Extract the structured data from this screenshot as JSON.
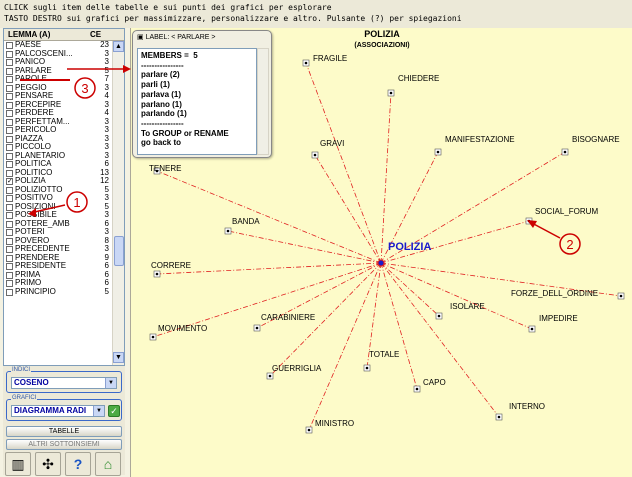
{
  "hint": {
    "line1": "CLICK sugli item delle tabelle e sui punti dei grafici per esplorare",
    "line2": "TASTO DESTRO sui grafici per massimizzare, personalizzare e altro. Pulsante (?) per spiegazioni"
  },
  "list": {
    "col_lemma": "LEMMA (A)",
    "col_ce": "CE",
    "items": [
      {
        "label": "PAESE",
        "ce": "23",
        "checked": false
      },
      {
        "label": "PALCOSCENI...",
        "ce": "3",
        "checked": false
      },
      {
        "label": "PANICO",
        "ce": "3",
        "checked": false
      },
      {
        "label": "PARLARE",
        "ce": "5",
        "checked": false
      },
      {
        "label": "PAROLE",
        "ce": "7",
        "checked": false
      },
      {
        "label": "PEGGIO",
        "ce": "3",
        "checked": false
      },
      {
        "label": "PENSARE",
        "ce": "4",
        "checked": false
      },
      {
        "label": "PERCEPIRE",
        "ce": "3",
        "checked": false
      },
      {
        "label": "PERDERE",
        "ce": "4",
        "checked": false
      },
      {
        "label": "PERFETTAM...",
        "ce": "3",
        "checked": false
      },
      {
        "label": "PERICOLO",
        "ce": "3",
        "checked": false
      },
      {
        "label": "PIAZZA",
        "ce": "3",
        "checked": false
      },
      {
        "label": "PICCOLO",
        "ce": "3",
        "checked": false
      },
      {
        "label": "PLANETARIO",
        "ce": "3",
        "checked": false
      },
      {
        "label": "POLITICA",
        "ce": "6",
        "checked": false
      },
      {
        "label": "POLITICO",
        "ce": "13",
        "checked": false
      },
      {
        "label": "POLIZIA",
        "ce": "12",
        "checked": true
      },
      {
        "label": "POLIZIOTTO",
        "ce": "5",
        "checked": false
      },
      {
        "label": "POSITIVO",
        "ce": "3",
        "checked": false
      },
      {
        "label": "POSIZIONI",
        "ce": "5",
        "checked": false
      },
      {
        "label": "POSSIBILE",
        "ce": "3",
        "checked": false
      },
      {
        "label": "POTERE_AMB",
        "ce": "6",
        "checked": false
      },
      {
        "label": "POTERI",
        "ce": "3",
        "checked": false
      },
      {
        "label": "POVERO",
        "ce": "8",
        "checked": false
      },
      {
        "label": "PRECEDENTE",
        "ce": "3",
        "checked": false
      },
      {
        "label": "PRENDERE",
        "ce": "9",
        "checked": false
      },
      {
        "label": "PRESIDENTE",
        "ce": "6",
        "checked": false
      },
      {
        "label": "PRIMA",
        "ce": "6",
        "checked": false
      },
      {
        "label": "PRIMO",
        "ce": "6",
        "checked": false
      },
      {
        "label": "PRINCIPIO",
        "ce": "5",
        "checked": false
      }
    ]
  },
  "indici": {
    "title": "INDICI",
    "value": "COSENO"
  },
  "grafici": {
    "title": "GRAFICI",
    "value": "DIAGRAMMA RADI"
  },
  "buttons": {
    "tabelle": "TABELLE",
    "altri": "ALTRI SOTTOINSIEMI"
  },
  "label_window": {
    "title": "LABEL: < PARLARE >",
    "lines": [
      "MEMBERS =  5",
      "----------------",
      "parlare (2)",
      "parli (1)",
      "parlava (1)",
      "parlano (1)",
      "parlando (1)",
      "----------------",
      "To GROUP or RENAME",
      "go back to"
    ]
  },
  "graph": {
    "title": "POLIZIA",
    "subtitle": "(ASSOCIAZIONI)",
    "center": "POLIZIA",
    "nodes": [
      "FRAGILE",
      "CHIEDERE",
      "GRAVI",
      "MANIFESTAZIONE",
      "BISOGNARE",
      "TENERE",
      "BANDA",
      "SOCIAL_FORUM",
      "CORRERE",
      "FORZE_DELL_ORDINE",
      "MOVIMENTO",
      "CARABINIERE",
      "ISOLARE",
      "IMPEDIRE",
      "TOTALE",
      "GUERRIGLIA",
      "CAPO",
      "INTERNO",
      "MINISTRO"
    ]
  },
  "annotations": {
    "one": "1",
    "two": "2",
    "three": "3"
  },
  "colors": {
    "accent": "#cc0000",
    "center_label": "#1a1acc",
    "canvas_bg": "#fdfbc9"
  }
}
